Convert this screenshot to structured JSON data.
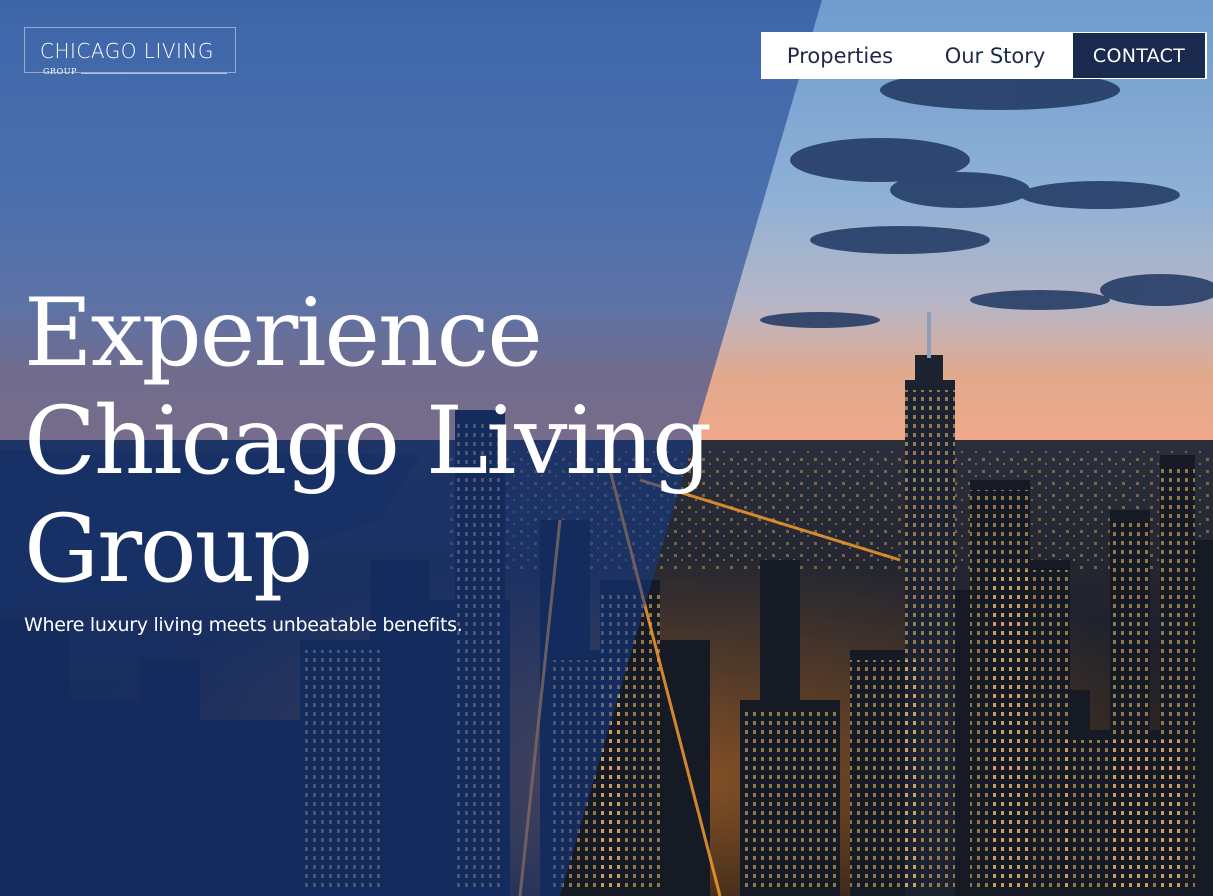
{
  "brand": {
    "name": "CHICAGO LIVING",
    "sub": "GROUP"
  },
  "nav": {
    "properties": "Properties",
    "our_story": "Our Story",
    "contact": "CONTACT"
  },
  "hero": {
    "headline_line1": "Experience",
    "headline_line2": "Chicago Living",
    "headline_line3": "Group",
    "tagline": "Where luxury living meets unbeatable benefits."
  },
  "colors": {
    "nav_text": "#1c2a48",
    "contact_bg": "#1a2a4e",
    "overlay_blue": "#143a8c"
  }
}
